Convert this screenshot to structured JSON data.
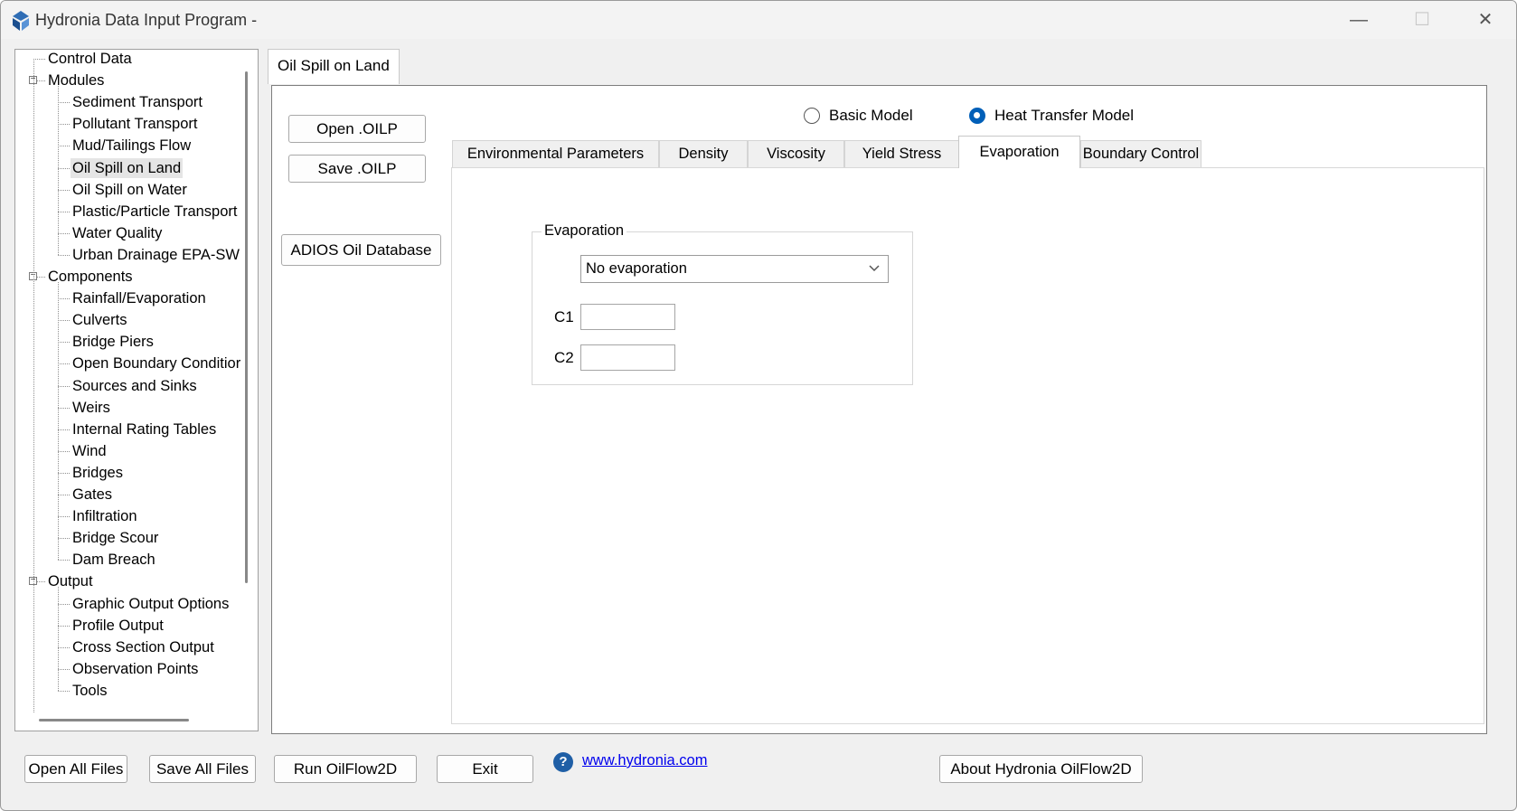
{
  "window": {
    "title": "Hydronia Data Input Program -",
    "minimize_glyph": "—",
    "maximize_glyph": "☐",
    "close_glyph": "✕"
  },
  "tree": {
    "items": [
      {
        "label": "Control Data",
        "level": 0
      },
      {
        "label": "Modules",
        "level": 0,
        "expandable": true
      },
      {
        "label": "Sediment Transport",
        "level": 1
      },
      {
        "label": "Pollutant Transport",
        "level": 1
      },
      {
        "label": "Mud/Tailings Flow",
        "level": 1
      },
      {
        "label": "Oil Spill on Land",
        "level": 1,
        "selected": true
      },
      {
        "label": "Oil Spill on Water",
        "level": 1
      },
      {
        "label": "Plastic/Particle Transport",
        "level": 1
      },
      {
        "label": "Water Quality",
        "level": 1
      },
      {
        "label": "Urban Drainage EPA-SW",
        "level": 1
      },
      {
        "label": "Components",
        "level": 0,
        "expandable": true
      },
      {
        "label": "Rainfall/Evaporation",
        "level": 1
      },
      {
        "label": "Culverts",
        "level": 1
      },
      {
        "label": "Bridge Piers",
        "level": 1
      },
      {
        "label": "Open Boundary Conditior",
        "level": 1
      },
      {
        "label": "Sources and Sinks",
        "level": 1
      },
      {
        "label": "Weirs",
        "level": 1
      },
      {
        "label": "Internal Rating Tables",
        "level": 1
      },
      {
        "label": "Wind",
        "level": 1
      },
      {
        "label": "Bridges",
        "level": 1
      },
      {
        "label": "Gates",
        "level": 1
      },
      {
        "label": "Infiltration",
        "level": 1
      },
      {
        "label": "Bridge Scour",
        "level": 1
      },
      {
        "label": "Dam Breach",
        "level": 1
      },
      {
        "label": "Output",
        "level": 0,
        "expandable": true
      },
      {
        "label": "Graphic Output Options",
        "level": 1
      },
      {
        "label": "Profile Output",
        "level": 1
      },
      {
        "label": "Cross Section Output",
        "level": 1
      },
      {
        "label": "Observation Points",
        "level": 1
      },
      {
        "label": "Tools",
        "level": 1
      }
    ]
  },
  "main": {
    "outer_tab": "Oil Spill on Land",
    "buttons": {
      "open_oilp": "Open .OILP",
      "save_oilp": "Save .OILP",
      "adios": "ADIOS Oil Database"
    },
    "radios": {
      "basic": {
        "label": "Basic Model",
        "checked": false
      },
      "heat": {
        "label": "Heat Transfer Model",
        "checked": true
      }
    },
    "tabs": [
      {
        "label": "Environmental Parameters"
      },
      {
        "label": "Density"
      },
      {
        "label": "Viscosity"
      },
      {
        "label": "Yield Stress"
      },
      {
        "label": "Evaporation",
        "active": true
      },
      {
        "label": "Boundary Control"
      }
    ],
    "evaporation": {
      "group_title": "Evaporation",
      "selected_option": "No evaporation",
      "c1_label": "C1",
      "c1_value": "",
      "c2_label": "C2",
      "c2_value": ""
    }
  },
  "bottom": {
    "open_all": "Open All Files",
    "save_all": "Save All Files",
    "run": "Run OilFlow2D",
    "exit": "Exit",
    "help_glyph": "?",
    "link": "www.hydronia.com",
    "about": "About Hydronia OilFlow2D"
  },
  "colors": {
    "accent": "#005fb8",
    "link": "#0000ee",
    "help_icon": "#1f5fa6"
  }
}
